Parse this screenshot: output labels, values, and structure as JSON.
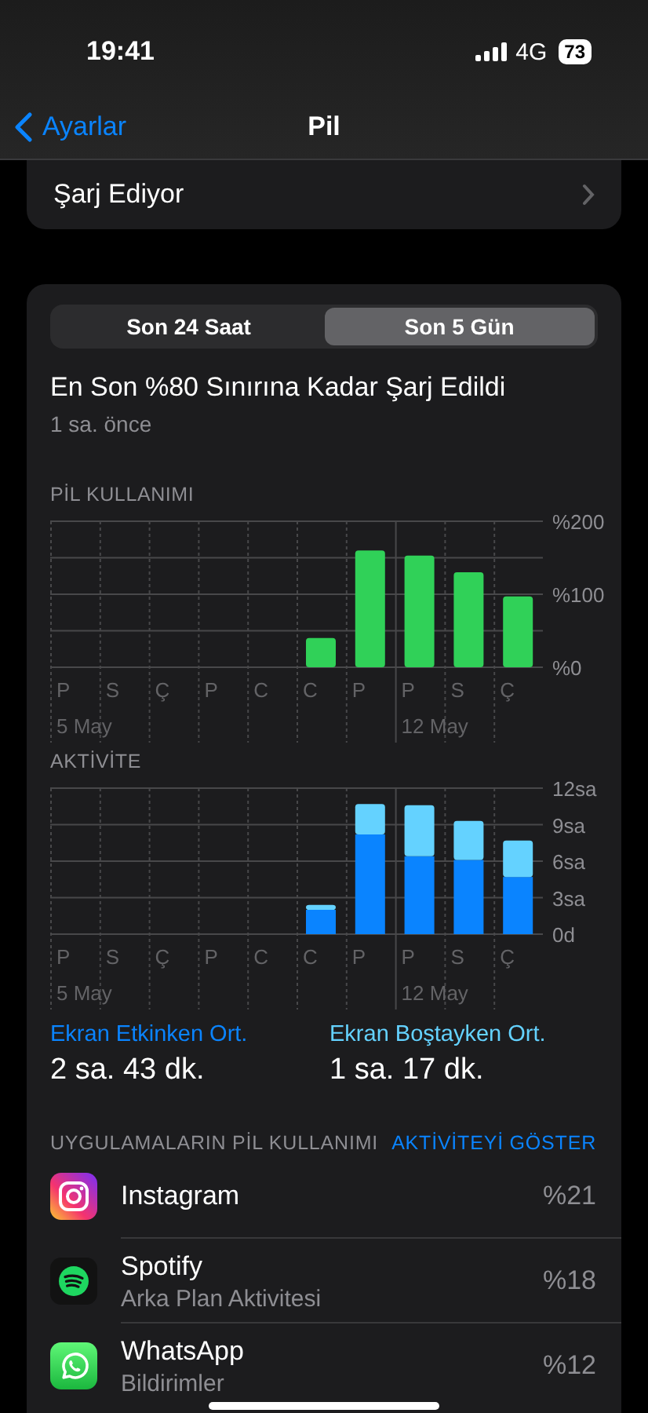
{
  "status_bar": {
    "time": "19:41",
    "network": "4G",
    "battery": "73"
  },
  "nav": {
    "back": "Ayarlar",
    "title": "Pil"
  },
  "charging_row": {
    "label": "Şarj Ediyor"
  },
  "segments": [
    {
      "label": "Son 24 Saat",
      "selected": false
    },
    {
      "label": "Son 5 Gün",
      "selected": true
    }
  ],
  "last_charge": {
    "title": "En Son %80 Sınırına Kadar Şarj Edildi",
    "subtitle": "1 sa. önce"
  },
  "battery_chart": {
    "chart_data": {
      "type": "bar",
      "title": "PİL KULLANIMI",
      "categories": [
        "P",
        "S",
        "Ç",
        "P",
        "C",
        "C",
        "P",
        "P",
        "S",
        "Ç"
      ],
      "series": [
        {
          "color": "#30d158",
          "values": [
            null,
            null,
            null,
            null,
            null,
            40,
            160,
            153,
            130,
            97
          ]
        }
      ],
      "ylim": [
        0,
        200
      ],
      "grid": true,
      "yticks": [
        {
          "value": 0,
          "label": "%0"
        },
        {
          "value": 100,
          "label": "%100"
        },
        {
          "value": 200,
          "label": "%200"
        }
      ]
    },
    "week_labels": [
      "5 May",
      "12 May"
    ]
  },
  "activity_chart": {
    "chart_data": {
      "type": "bar",
      "title": "AKTİVİTE",
      "stacked": true,
      "categories": [
        "P",
        "S",
        "Ç",
        "P",
        "C",
        "C",
        "P",
        "P",
        "S",
        "Ç"
      ],
      "series": [
        {
          "color": "#0a84ff",
          "values": [
            null,
            null,
            null,
            null,
            null,
            2.0,
            8.2,
            6.4,
            6.1,
            4.7
          ]
        },
        {
          "color": "#64d2ff",
          "values": [
            null,
            null,
            null,
            null,
            null,
            0.4,
            2.5,
            4.2,
            3.2,
            3.0
          ]
        }
      ],
      "ylim": [
        0,
        12
      ],
      "grid": true,
      "yticks": [
        {
          "value": 0,
          "label": "0d"
        },
        {
          "value": 3,
          "label": "3sa"
        },
        {
          "value": 6,
          "label": "6sa"
        },
        {
          "value": 9,
          "label": "9sa"
        },
        {
          "value": 12,
          "label": "12sa"
        }
      ]
    },
    "week_labels": [
      "5 May",
      "12 May"
    ]
  },
  "averages": [
    {
      "label": "Ekran Etkinken Ort.",
      "value": "2 sa. 43 dk.",
      "color": "#0a84ff"
    },
    {
      "label": "Ekran Boştayken Ort.",
      "value": "1 sa. 17 dk.",
      "color": "#64d2ff"
    }
  ],
  "apps_header": {
    "title": "UYGULAMALARIN PİL KULLANIMI",
    "action": "AKTİVİTEYİ GÖSTER"
  },
  "apps": [
    {
      "kind": "instagram",
      "name": "Instagram",
      "percent": "%21"
    },
    {
      "kind": "spotify",
      "name": "Spotify",
      "detail": "Arka Plan Aktivitesi",
      "percent": "%18"
    },
    {
      "kind": "whatsapp",
      "name": "WhatsApp",
      "detail": "Bildirimler",
      "percent": "%12"
    }
  ]
}
